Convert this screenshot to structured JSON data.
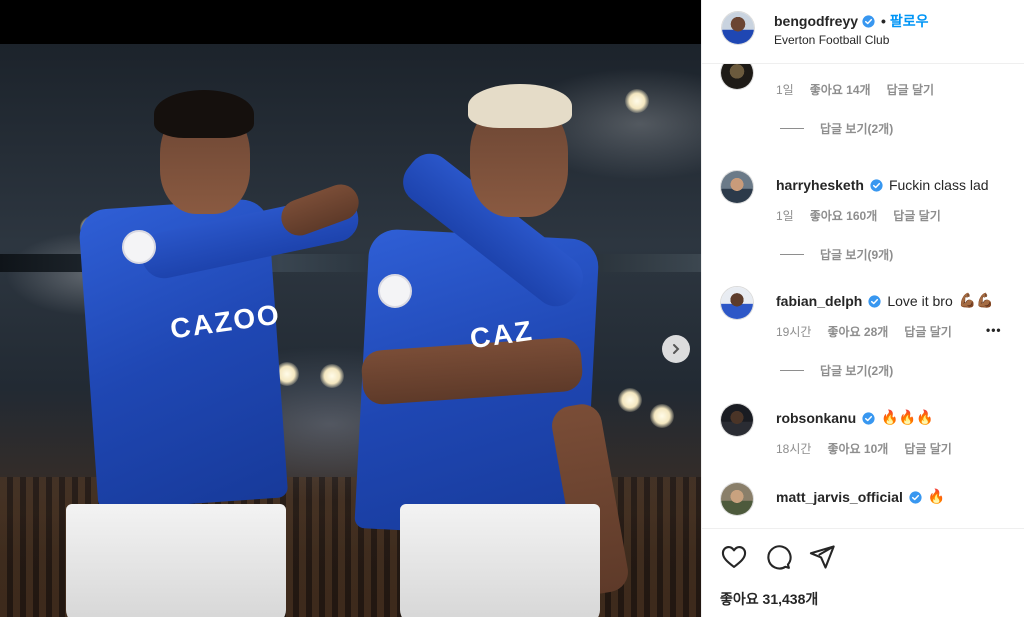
{
  "post": {
    "author": {
      "username": "bengodfreyy",
      "follow_label": "팔로우",
      "separator": "•",
      "location": "Everton Football Club"
    },
    "media": {
      "sponsor_text": "CAZOO",
      "sponsor_text_partial": "CAZ"
    },
    "comments": [
      {
        "username": "",
        "text": "",
        "time": "1일",
        "likes": "좋아요 14개",
        "reply": "답글 달기",
        "view_replies": "답글 보기(2개)"
      },
      {
        "username": "harryhesketh",
        "text": "Fuckin class lad",
        "time": "1일",
        "likes": "좋아요 160개",
        "reply": "답글 달기",
        "view_replies": "답글 보기(9개)"
      },
      {
        "username": "fabian_delph",
        "text": "Love it bro",
        "emoji": "💪🏾💪🏾",
        "time": "19시간",
        "likes": "좋아요 28개",
        "reply": "답글 달기",
        "more": "•••",
        "view_replies": "답글 보기(2개)"
      },
      {
        "username": "robsonkanu",
        "text": "",
        "emoji": "🔥🔥🔥",
        "time": "18시간",
        "likes": "좋아요 10개",
        "reply": "답글 달기"
      },
      {
        "username": "matt_jarvis_official",
        "text": "",
        "emoji": "🔥"
      }
    ],
    "like_count": "좋아요 31,438개"
  },
  "icons": {
    "verified": "verified-badge-icon",
    "heart": "heart-icon",
    "comment": "comment-icon",
    "share": "paper-plane-icon",
    "next": "chevron-right-icon",
    "more": "more-options-icon"
  },
  "colors": {
    "accent": "#0095f6",
    "verified": "#3897f0",
    "kit_blue": "#1f47b3",
    "fire": "#f26a1b"
  }
}
